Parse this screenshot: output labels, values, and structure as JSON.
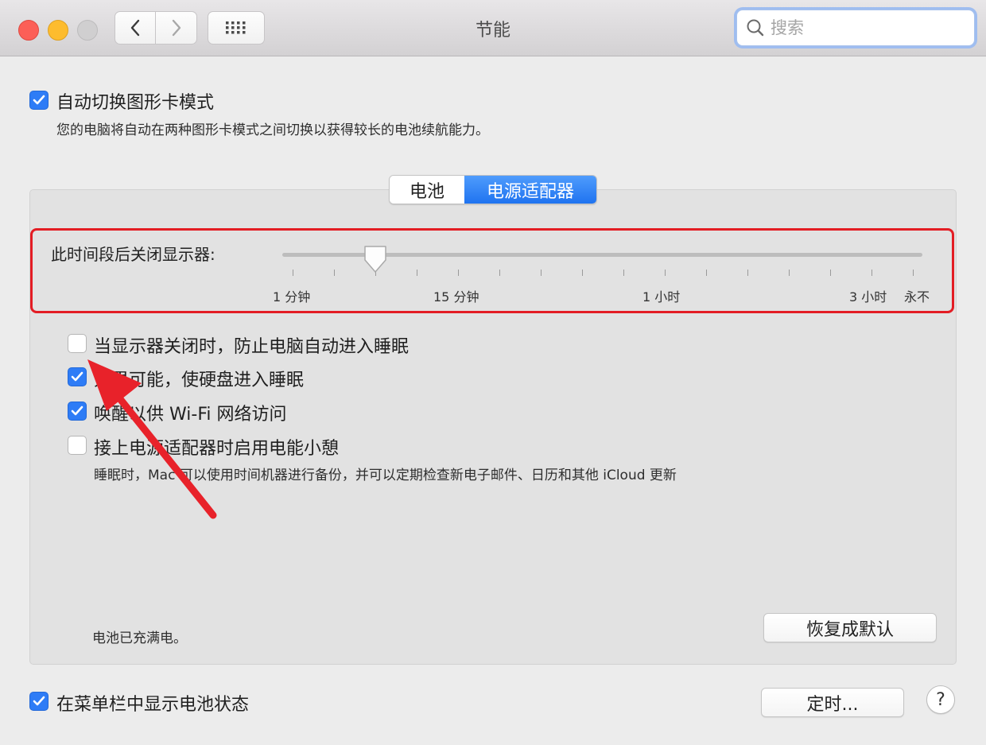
{
  "window": {
    "title": "节能",
    "search_placeholder": "搜索"
  },
  "toolbar": {
    "back_icon": "chevron-left-icon",
    "forward_icon": "chevron-right-icon",
    "grid_icon": "grid-icon"
  },
  "gpu_switch": {
    "checked": true,
    "label": "自动切换图形卡模式",
    "description": "您的电脑将自动在两种图形卡模式之间切换以获得较长的电池续航能力。"
  },
  "tabs": [
    {
      "label": "电池",
      "selected": false
    },
    {
      "label": "电源适配器",
      "selected": true
    }
  ],
  "display_sleep": {
    "label": "此时间段后关闭显示器:",
    "tick_labels": [
      "1 分钟",
      "15 分钟",
      "1 小时",
      "3 小时",
      "永不"
    ],
    "value_fraction": 0.145
  },
  "options": [
    {
      "label": "当显示器关闭时，防止电脑自动进入睡眠",
      "checked": false
    },
    {
      "label": "如果可能，使硬盘进入睡眠",
      "checked": true
    },
    {
      "label": "唤醒以供 Wi-Fi 网络访问",
      "checked": true
    },
    {
      "label": "接上电源适配器时启用电能小憩",
      "checked": false
    }
  ],
  "power_nap_description": "睡眠时，Mac 可以使用时间机器进行备份，并可以定期检查新电子邮件、日历和其他 iCloud 更新",
  "battery_status": "电池已充满电。",
  "restore_defaults_label": "恢复成默认",
  "show_battery_status": {
    "checked": true,
    "label": "在菜单栏中显示电池状态"
  },
  "schedule_label": "定时...",
  "help_label": "?",
  "colors": {
    "accent": "#2e7cf6",
    "highlight_box": "#e31d24",
    "annotation_arrow": "#e8222a"
  }
}
